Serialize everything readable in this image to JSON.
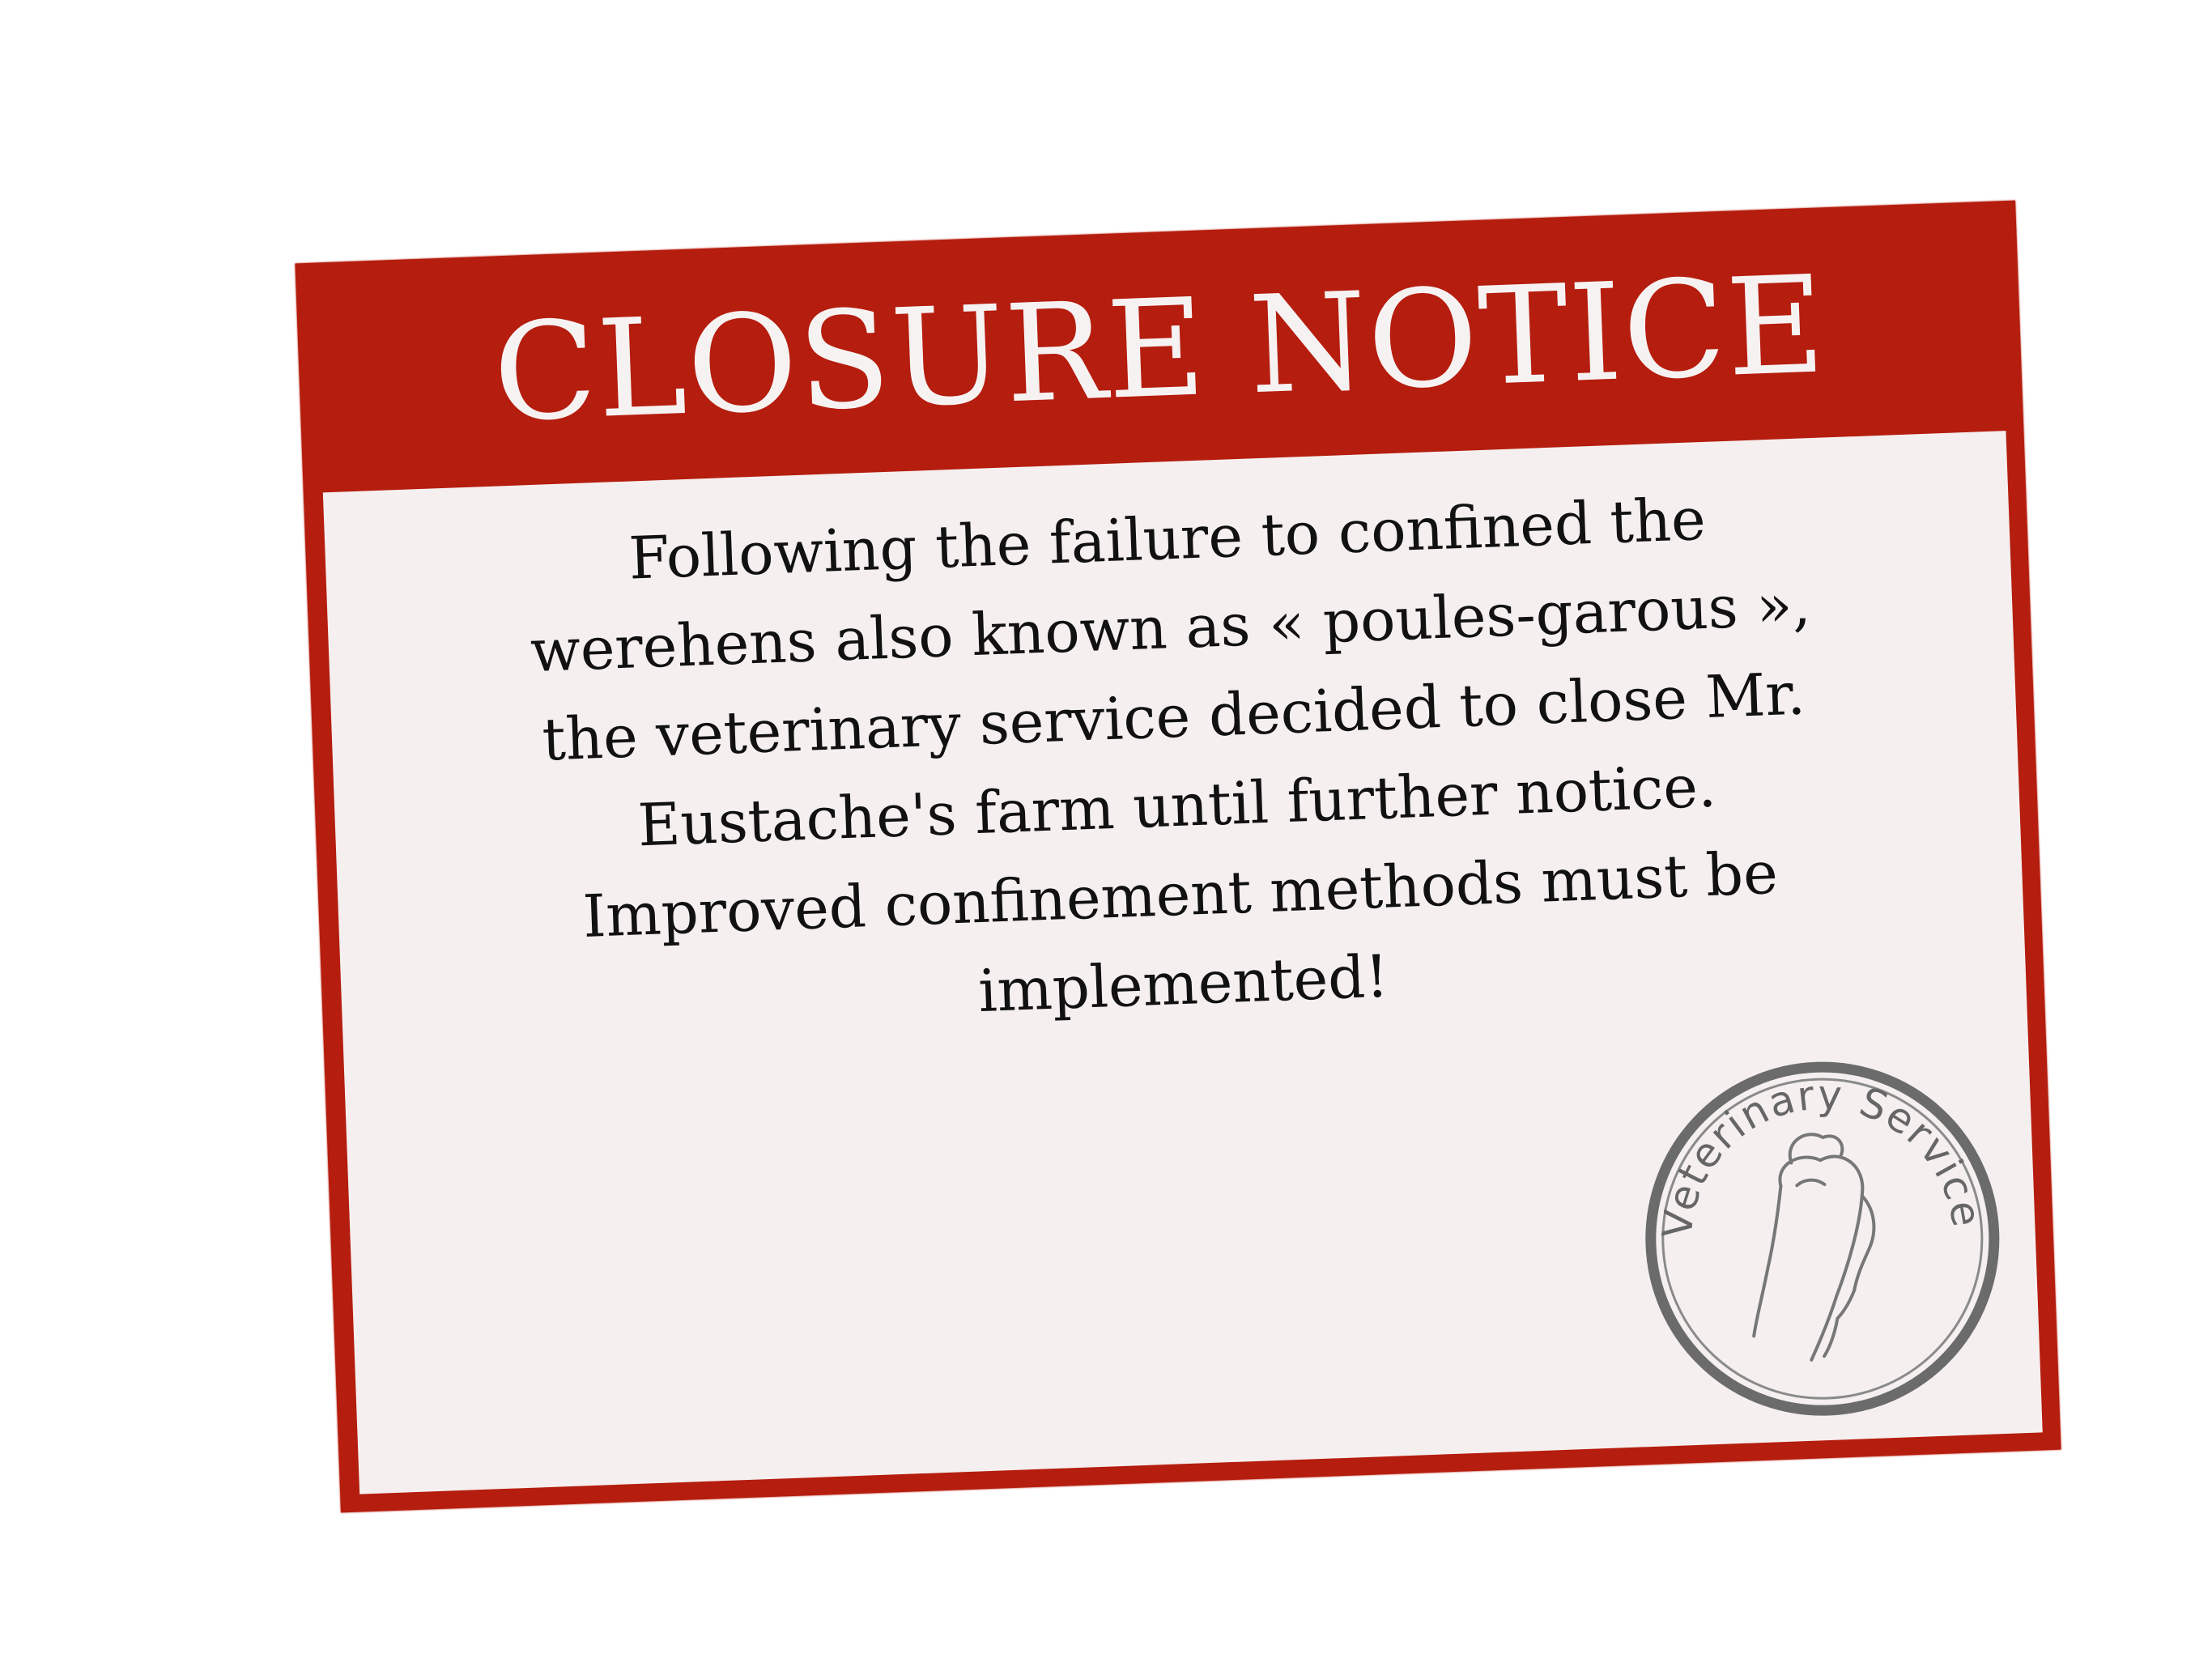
{
  "notice": {
    "title": "CLOSURE NOTICE",
    "body_lines": [
      "Following the failure to confined the",
      "werehens also known as « poules-garous »,",
      "the veterinary service decided to close Mr.",
      "Eustache's farm until further notice.",
      "Improved confinement methods must be",
      "implemented!"
    ]
  },
  "stamp": {
    "text": "Veterinary Service",
    "icon": "hen-outline-icon"
  },
  "colors": {
    "banner": "#b51d0e",
    "body_background": "#f5efef",
    "title_text": "#f7f2f2",
    "body_text": "#111111",
    "stamp_ink": "#6b6b6b"
  }
}
